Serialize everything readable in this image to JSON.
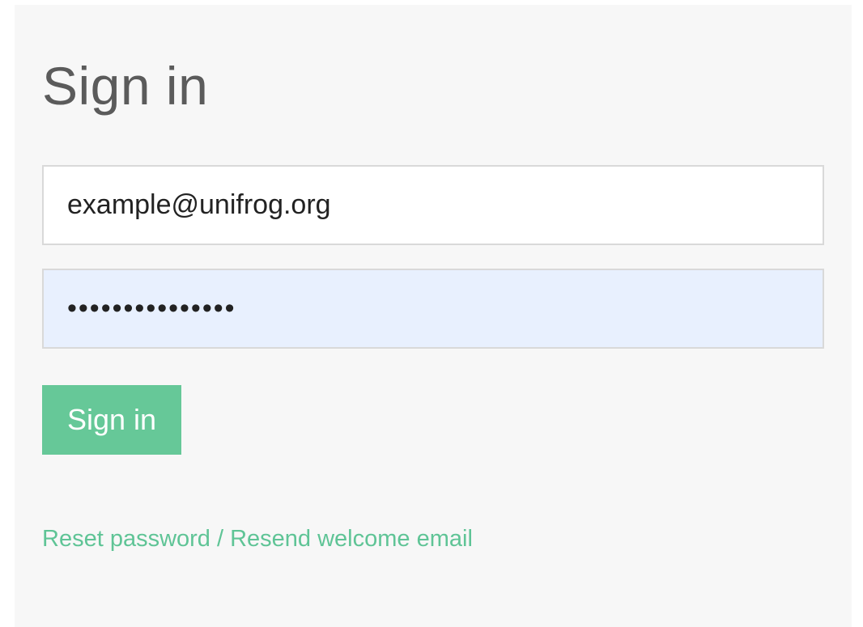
{
  "form": {
    "title": "Sign in",
    "email_value": "example@unifrog.org",
    "password_value": "passwordpasswor",
    "submit_label": "Sign in",
    "reset_link_label": "Reset password / Resend welcome email"
  },
  "colors": {
    "panel_background": "#f7f7f7",
    "accent": "#66c898",
    "link": "#5fc496",
    "autofill_background": "#e8f0fe",
    "title_text": "#5b5b5b"
  }
}
